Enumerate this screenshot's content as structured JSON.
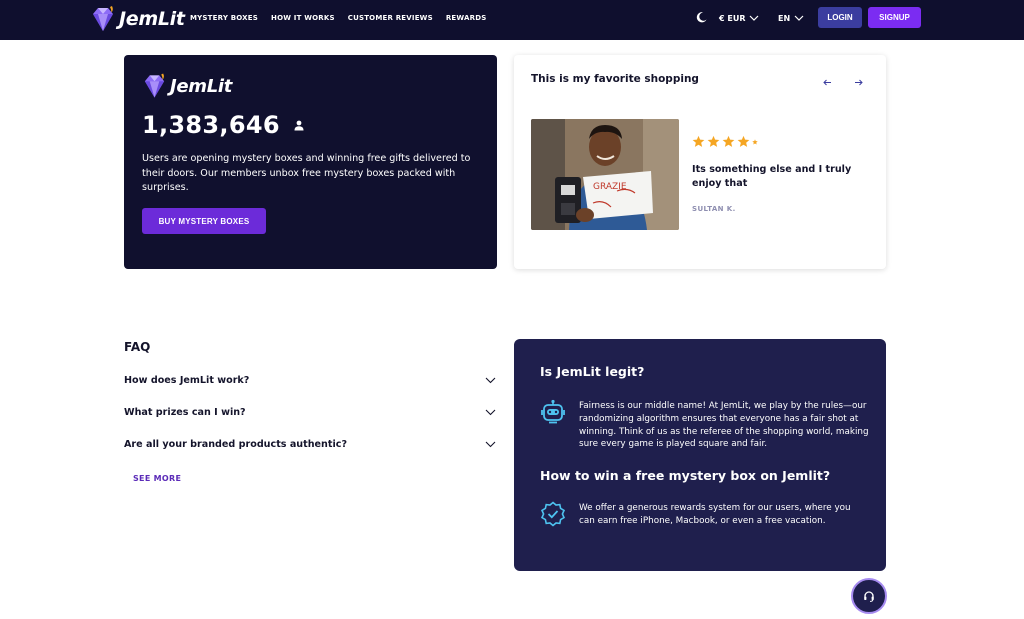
{
  "brand": {
    "name": "JemLit"
  },
  "nav": {
    "links": [
      "MYSTERY BOXES",
      "HOW IT WORKS",
      "CUSTOMER REVIEWS",
      "REWARDS"
    ],
    "currency": "€ EUR",
    "language": "EN",
    "login_label": "LOGIN",
    "signup_label": "SIGNUP"
  },
  "hero": {
    "user_count": "1,383,646",
    "description": "Users are opening mystery boxes and winning free gifts delivered to their doors. Our members unbox free mystery boxes packed with surprises.",
    "cta_label": "BUY MYSTERY BOXES"
  },
  "review": {
    "title": "This is my favorite shopping",
    "rating": 4.5,
    "rating_max": 5,
    "quote": "Its something else and I truly enjoy that",
    "author": "SULTAN K.",
    "sign_text": "GRAZIE"
  },
  "faq": {
    "title": "FAQ",
    "items": [
      "How does JemLit work?",
      "What prizes can I win?",
      "Are all your branded products authentic?"
    ],
    "see_more_label": "SEE MORE"
  },
  "info": {
    "legit_title": "Is JemLit legit?",
    "legit_text": "Fairness is our middle name! At JemLit, we play by the rules—our randomizing algorithm ensures that everyone has a fair shot at winning. Think of us as the referee of the shopping world, making sure every game is played square and fair.",
    "win_title": "How to win a free mystery box on Jemlit?",
    "win_text": "We offer a generous rewards system for our users, where you can earn free iPhone, Macbook, or even a free vacation."
  },
  "icons": {
    "logo": "gem-icon",
    "theme": "moon-icon",
    "user": "user-icon",
    "robot": "robot-icon",
    "badge": "verified-badge-icon",
    "support": "headset-icon",
    "star": "star-icon",
    "chevron": "chevron-down-icon"
  },
  "colors": {
    "nav_bg": "#0f0f2e",
    "hero_bg": "#10102e",
    "info_bg": "#1f1f4d",
    "accent_purple": "#7b2cf2",
    "login_blue": "#3b3d9f",
    "star": "#f5a623"
  }
}
